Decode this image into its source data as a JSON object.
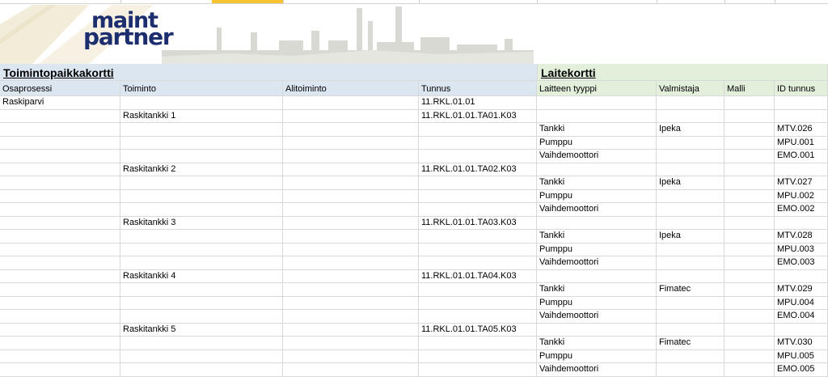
{
  "logo": {
    "line1": "maint",
    "line2": "partner"
  },
  "sections": {
    "left_title": "Toimintopaikkakortti",
    "right_title": "Laitekortti"
  },
  "columns": [
    "Osaprosessi",
    "Toiminto",
    "Alitoiminto",
    "Tunnus",
    "Laitteen tyyppi",
    "Valmistaja",
    "Malli",
    "ID tunnus"
  ],
  "rows": [
    [
      "Raskiparvi",
      "",
      "",
      "11.RKL.01.01",
      "",
      "",
      "",
      ""
    ],
    [
      "",
      "Raskitankki 1",
      "",
      "11.RKL.01.01.TA01.K03",
      "",
      "",
      "",
      ""
    ],
    [
      "",
      "",
      "",
      "",
      "Tankki",
      "Ipeka",
      "",
      "MTV.026"
    ],
    [
      "",
      "",
      "",
      "",
      "Pumppu",
      "",
      "",
      "MPU.001"
    ],
    [
      "",
      "",
      "",
      "",
      "Vaihdemoottori",
      "",
      "",
      "EMO.001"
    ],
    [
      "",
      "Raskitankki 2",
      "",
      "11.RKL.01.01.TA02.K03",
      "",
      "",
      "",
      ""
    ],
    [
      "",
      "",
      "",
      "",
      "Tankki",
      "Ipeka",
      "",
      "MTV.027"
    ],
    [
      "",
      "",
      "",
      "",
      "Pumppu",
      "",
      "",
      "MPU.002"
    ],
    [
      "",
      "",
      "",
      "",
      "Vaihdemoottori",
      "",
      "",
      "EMO.002"
    ],
    [
      "",
      "Raskitankki 3",
      "",
      "11.RKL.01.01.TA03.K03",
      "",
      "",
      "",
      ""
    ],
    [
      "",
      "",
      "",
      "",
      "Tankki",
      "Ipeka",
      "",
      "MTV.028"
    ],
    [
      "",
      "",
      "",
      "",
      "Pumppu",
      "",
      "",
      "MPU.003"
    ],
    [
      "",
      "",
      "",
      "",
      "Vaihdemoottori",
      "",
      "",
      "EMO.003"
    ],
    [
      "",
      "Raskitankki 4",
      "",
      "11.RKL.01.01.TA04.K03",
      "",
      "",
      "",
      ""
    ],
    [
      "",
      "",
      "",
      "",
      "Tankki",
      "Fimatec",
      "",
      "MTV.029"
    ],
    [
      "",
      "",
      "",
      "",
      "Pumppu",
      "",
      "",
      "MPU.004"
    ],
    [
      "",
      "",
      "",
      "",
      "Vaihdemoottori",
      "",
      "",
      "EMO.004"
    ],
    [
      "",
      "Raskitankki 5",
      "",
      "11.RKL.01.01.TA05.K03",
      "",
      "",
      "",
      ""
    ],
    [
      "",
      "",
      "",
      "",
      "Tankki",
      "Fimatec",
      "",
      "MTV.030"
    ],
    [
      "",
      "",
      "",
      "",
      "Pumppu",
      "",
      "",
      "MPU.005"
    ],
    [
      "",
      "",
      "",
      "",
      "Vaihdemoottori",
      "",
      "",
      "EMO.005"
    ]
  ],
  "colors": {
    "left_header_bg": "#dce6f1",
    "right_header_bg": "#e2efda",
    "logo": "#1c2e6e",
    "selection": "#f7c332"
  }
}
